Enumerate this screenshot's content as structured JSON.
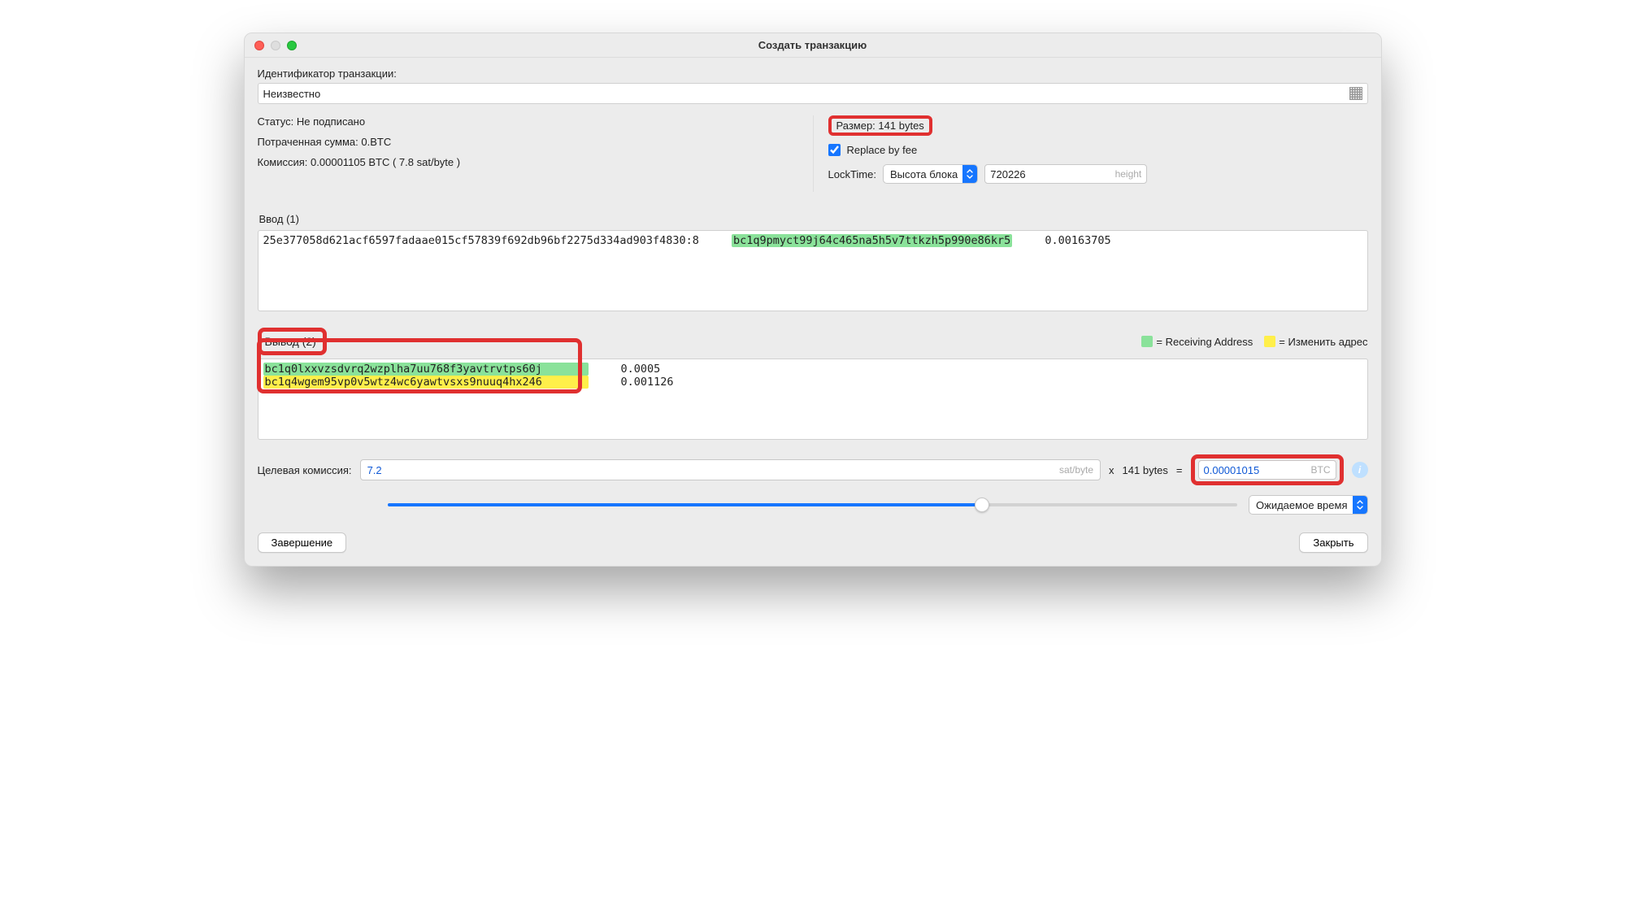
{
  "window": {
    "title": "Создать транзакцию"
  },
  "txid": {
    "label": "Идентификатор транзакции:",
    "value": "Неизвестно"
  },
  "status": {
    "label": "Статус:",
    "value": "Не подписано"
  },
  "spent": {
    "label": "Потраченная сумма:",
    "value": "0.BTC"
  },
  "fee": {
    "label": "Комиссия:",
    "value": "0.00001105 BTC  ( 7.8 sat/byte )"
  },
  "size": {
    "label": "Размер:",
    "value": "141 bytes"
  },
  "rbf": {
    "label": "Replace by fee"
  },
  "locktime": {
    "label": "LockTime:",
    "mode": "Высота блока",
    "value": "720226",
    "unit": "height"
  },
  "inputs": {
    "label": "Ввод (1)",
    "rows": [
      {
        "outpoint": "25e377058d621acf6597fadaae015cf57839f692db96bf2275d334ad903f4830:8",
        "address": "bc1q9pmyct99j64c465na5h5v7ttkzh5p990e86kr5",
        "amount": "0.00163705"
      }
    ]
  },
  "outputs": {
    "label": "Вывод (2)",
    "legend_recv": "= Receiving Address",
    "legend_change": "= Изменить адрес",
    "rows": [
      {
        "address": "bc1q0lxxvzsdvrq2wzplha7uu768f3yavtrvtps60j",
        "amount": "0.0005",
        "kind": "recv"
      },
      {
        "address": "bc1q4wgem95vp0v5wtz4wc6yawtvsxs9nuuq4hx246",
        "amount": "0.001126",
        "kind": "change"
      }
    ]
  },
  "target_fee": {
    "label": "Целевая комиссия:",
    "rate": "7.2",
    "rate_unit": "sat/byte",
    "size": "141 bytes",
    "times": "x",
    "equals": "=",
    "result": "0.00001015",
    "result_unit": "BTC",
    "eta_label": "Ожидаемое время"
  },
  "buttons": {
    "finish": "Завершение",
    "close": "Закрыть"
  }
}
